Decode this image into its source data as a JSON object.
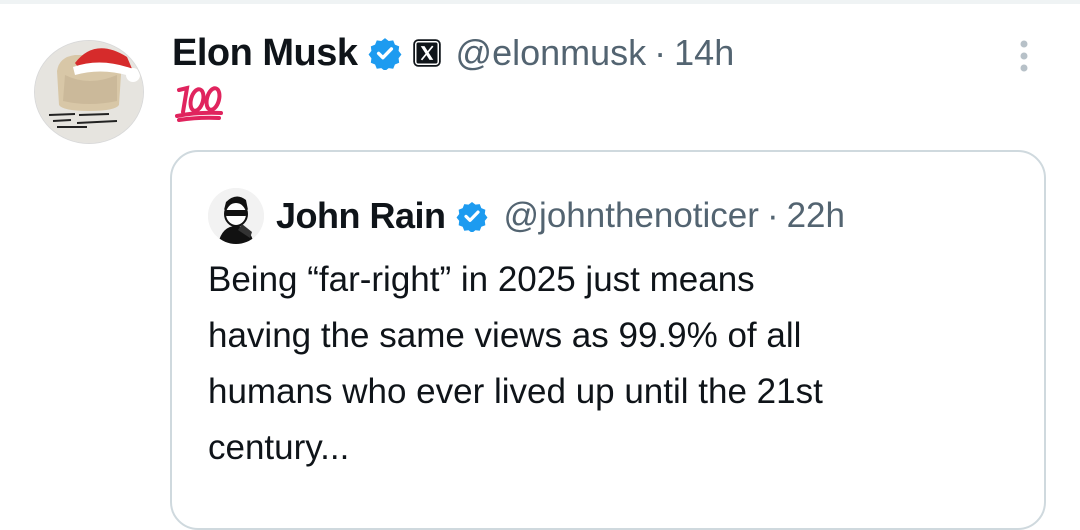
{
  "post": {
    "author_name": "Elon Musk",
    "handle": "@elonmusk",
    "separator": "·",
    "time": "14h",
    "avatar_icon": "santa-hat-avatar",
    "body_icon": "hundred-points-emoji",
    "verified_icon": "verified-badge-icon",
    "affiliation_icon": "x-logo-badge",
    "menu_icon": "more-options-icon"
  },
  "quoted_post": {
    "author_name": "John Rain",
    "handle": "@johnthenoticer",
    "separator": "·",
    "time": "22h",
    "avatar_icon": "sketch-portrait-avatar",
    "verified_icon": "verified-badge-icon",
    "text_lines": [
      "Being “far-right” in 2025 just means",
      "having the same views as 99.9% of all",
      "humans who ever lived up until the 21st",
      "century..."
    ]
  },
  "colors": {
    "verified": "#1d9bf0",
    "secondary_text": "#536471",
    "border": "#cfd9de",
    "hundred_red": "#e0245e"
  }
}
